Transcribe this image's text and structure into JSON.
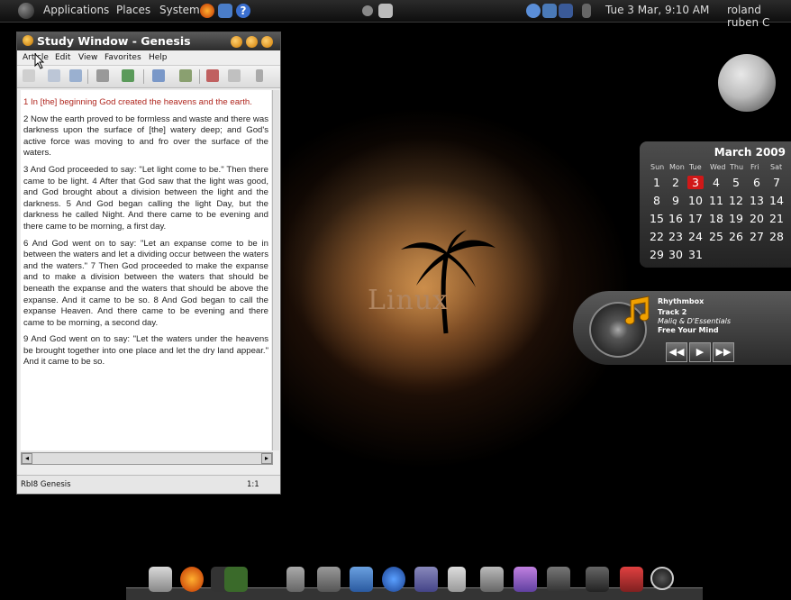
{
  "top_panel": {
    "menus": [
      "Applications",
      "Places",
      "System"
    ],
    "clock": "Tue 3 Mar, 9:10 AM",
    "user": "roland ruben C"
  },
  "window": {
    "title": "Study Window - Genesis",
    "menus": [
      "Article",
      "Edit",
      "View",
      "Favorites",
      "Help"
    ],
    "paragraphs": [
      "1 In [the] beginning God created the heavens and the earth.",
      "2 Now the earth proved to be formless and waste and there was darkness upon the surface of [the] watery deep; and God's active force was moving to and fro over the surface of the waters.",
      "3 And God proceeded to say: \"Let light come to be.\" Then there came to be light. 4 After that God saw that the light was good, and God brought about a division between the light and the darkness. 5 And God began calling the light Day, but the darkness he called Night. And there came to be evening and there came to be morning, a first day.",
      "6 And God went on to say: \"Let an expanse come to be in between the waters and let a dividing occur between the waters and the waters.\" 7 Then God proceeded to make the expanse and to make a division between the waters that should be beneath the expanse and the waters that should be above the expanse. And it came to be so. 8 And God began to call the expanse Heaven. And there came to be evening and there came to be morning, a second day.",
      "9 And God went on to say: \"Let the waters under the heavens be brought together into one place and let the dry land appear.\" And it came to be so."
    ],
    "status_left": "RbI8 Genesis",
    "status_right": "1:1"
  },
  "wallpaper": {
    "text": "Linux"
  },
  "calendar": {
    "month": "March 2009",
    "day_names": [
      "Sun",
      "Mon",
      "Tue",
      "Wed",
      "Thu",
      "Fri",
      "Sat"
    ],
    "today": 3,
    "weeks": [
      [
        "1",
        "2",
        "3",
        "4",
        "5",
        "6",
        "7"
      ],
      [
        "8",
        "9",
        "10",
        "11",
        "12",
        "13",
        "14"
      ],
      [
        "15",
        "16",
        "17",
        "18",
        "19",
        "20",
        "21"
      ],
      [
        "22",
        "23",
        "24",
        "25",
        "26",
        "27",
        "28"
      ],
      [
        "29",
        "30",
        "31",
        "",
        "",
        "",
        ""
      ]
    ]
  },
  "rhythmbox": {
    "app": "Rhythmbox",
    "track": "Track 2",
    "artist": "Maliq & D'Essentials",
    "album": "Free Your Mind",
    "controls": [
      "previous",
      "play",
      "next"
    ]
  },
  "colors": {
    "today": "#d01818",
    "verse_first": "#b0271f",
    "accent": "#e08a00"
  }
}
